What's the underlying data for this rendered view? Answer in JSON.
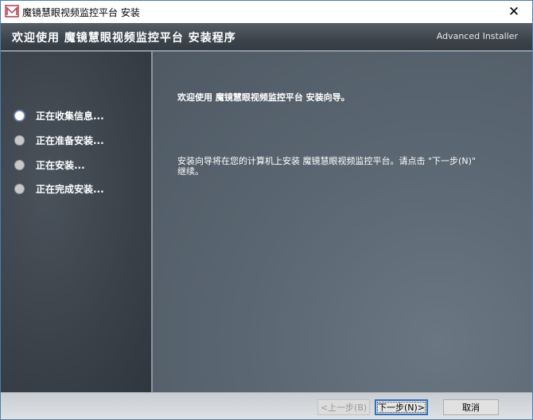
{
  "window": {
    "title": "魔镜慧眼视频监控平台 安装",
    "close_glyph": "✕"
  },
  "header": {
    "title": "欢迎使用 魔镜慧眼视频监控平台 安装程序",
    "brand": "Advanced Installer"
  },
  "sidebar": {
    "steps": [
      {
        "label": "正在收集信息...",
        "active": true
      },
      {
        "label": "正在准备安装...",
        "active": false
      },
      {
        "label": "正在安装...",
        "active": false
      },
      {
        "label": "正在完成安装...",
        "active": false
      }
    ]
  },
  "content": {
    "welcome": "欢迎使用 魔镜慧眼视频监控平台 安装向导。",
    "description": "安装向导将在您的计算机上安装 魔镜慧眼视频监控平台。请点击 \"下一步(N)\"\n继续。"
  },
  "footer": {
    "back_label": "<上一步(B)",
    "next_label": "下一步(N)>",
    "cancel_label": "取消"
  },
  "colors": {
    "header_bg": "#3d444c",
    "sidebar_bg": "#3b424a",
    "content_bg": "#5b6772",
    "accent": "#2d6fbf"
  }
}
